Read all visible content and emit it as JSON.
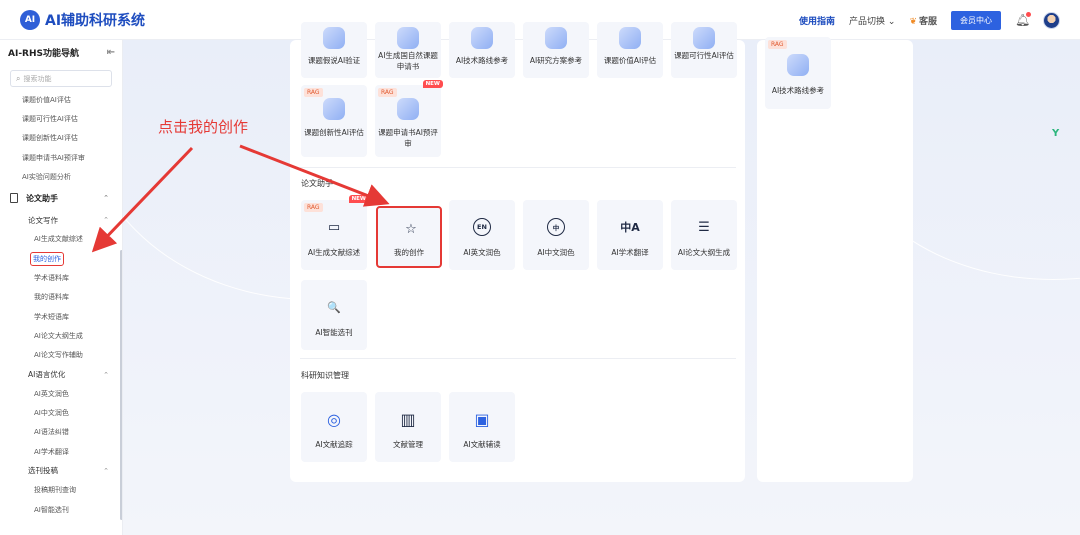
{
  "header": {
    "logo_mark": "AI",
    "app_title": "AI辅助科研系统",
    "guide": "使用指南",
    "product_switch": "产品切换",
    "service": "客服",
    "member_center": "会员中心"
  },
  "sidebar": {
    "title": "AI-RHS功能导航",
    "search_placeholder": "搜索功能",
    "items_top": [
      "课题价值AI评估",
      "课题可行性AI评估",
      "课题创新性AI评估",
      "课题申请书AI预评审",
      "AI实验问题分析"
    ],
    "group_paper": "论文助手",
    "sub_writing": "论文写作",
    "writing_items": [
      "AI生成文献综述",
      "我的创作",
      "学术语料库",
      "我的语料库",
      "学术短语库",
      "AI论文大纲生成",
      "AI论文写作辅助"
    ],
    "sub_lang": "AI语言优化",
    "lang_items": [
      "AI英文润色",
      "AI中文润色",
      "AI语法纠错",
      "AI学术翻译"
    ],
    "sub_submit": "选刊投稿",
    "submit_items": [
      "投稿期刊查询",
      "AI智能选刊"
    ]
  },
  "annotation": "点击我的创作",
  "top_cards": [
    {
      "label": "课题假说AI验证"
    },
    {
      "label": "AI生成国自然课题申请书"
    },
    {
      "label": "AI技术路线参考"
    },
    {
      "label": "AI研究方案参考"
    },
    {
      "label": "课题价值AI评估"
    },
    {
      "label": "课题可行性AI评估"
    }
  ],
  "rag_cards": [
    {
      "tag": "RAG",
      "label": "课题创新性AI评估"
    },
    {
      "tag": "RAG",
      "new": "NEW",
      "label": "课题申请书AI预评审"
    }
  ],
  "right_card": {
    "tag": "RAG",
    "label": "AI技术路线参考"
  },
  "section_paper": "论文助手",
  "paper_cards": [
    {
      "tag": "RAG",
      "new": "NEW",
      "label": "AI生成文献综述",
      "icon": "▭"
    },
    {
      "label": "我的创作",
      "icon": "☆"
    },
    {
      "label": "AI英文润色",
      "icon": "EN"
    },
    {
      "label": "AI中文润色",
      "icon": "中"
    },
    {
      "label": "AI学术翻译",
      "icon": "中A"
    },
    {
      "label": "AI论文大纲生成",
      "icon": "☰"
    },
    {
      "label": "AI智能选刊",
      "icon": "🔍"
    }
  ],
  "section_knowledge": "科研知识管理",
  "knowledge_cards": [
    {
      "label": "AI文献追踪",
      "icon": "◎"
    },
    {
      "label": "文献管理",
      "icon": "▥"
    },
    {
      "label": "AI文献辅读",
      "icon": "▣"
    }
  ],
  "colors": {
    "brand": "#2d62e0",
    "highlight": "#e53935"
  }
}
